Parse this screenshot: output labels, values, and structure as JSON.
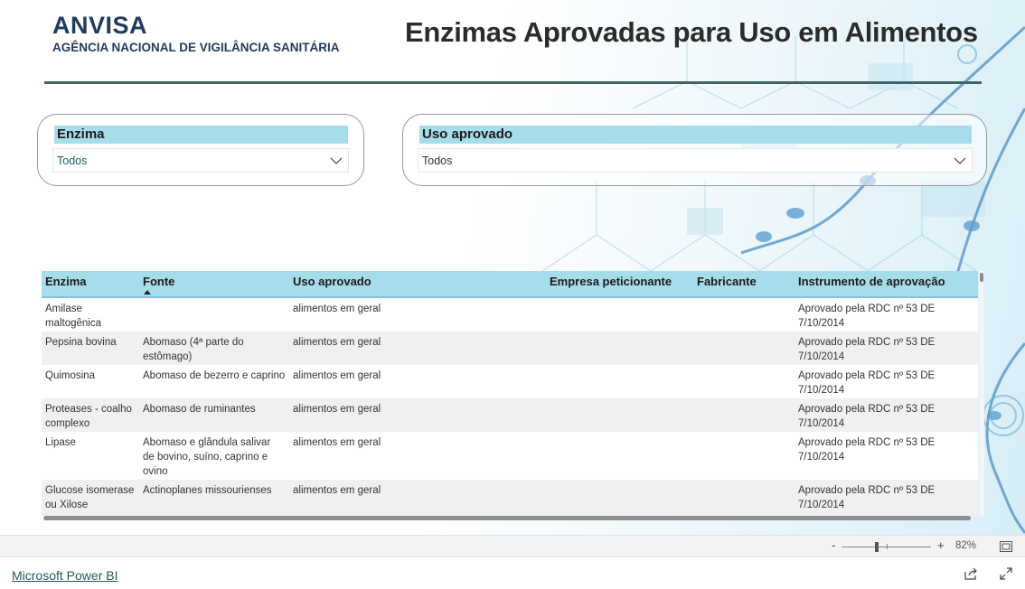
{
  "header": {
    "logo_title": "ANVISA",
    "logo_subtitle": "AGÊNCIA NACIONAL DE VIGILÂNCIA SANITÁRIA",
    "page_title": "Enzimas Aprovadas para Uso em Alimentos"
  },
  "slicers": {
    "enzima": {
      "label": "Enzima",
      "value": "Todos"
    },
    "uso": {
      "label": "Uso aprovado",
      "value": "Todos"
    }
  },
  "table": {
    "columns": [
      "Enzima",
      "Fonte",
      "Uso aprovado",
      "Empresa peticionante",
      "Fabricante",
      "Instrumento de aprovação"
    ],
    "sorted_column": "Fonte",
    "sort_direction": "ascending",
    "rows": [
      {
        "enzima": "Amilase maltogênica",
        "fonte": "",
        "uso": "alimentos em geral",
        "empresa": "",
        "fabricante": "",
        "instrumento": "Aprovado pela RDC nº 53 DE 7/10/2014"
      },
      {
        "enzima": "Pepsina bovina",
        "fonte": "Abomaso (4ª parte do estômago)",
        "uso": "alimentos em geral",
        "empresa": "",
        "fabricante": "",
        "instrumento": "Aprovado pela RDC nº 53 DE 7/10/2014"
      },
      {
        "enzima": "Quimosina",
        "fonte": "Abomaso de bezerro e caprino",
        "uso": "alimentos em geral",
        "empresa": "",
        "fabricante": "",
        "instrumento": "Aprovado pela RDC nº 53 DE 7/10/2014"
      },
      {
        "enzima": "Proteases - coalho complexo",
        "fonte": "Abomaso de ruminantes",
        "uso": "alimentos em geral",
        "empresa": "",
        "fabricante": "",
        "instrumento": "Aprovado pela RDC nº 53 DE 7/10/2014"
      },
      {
        "enzima": "Lipase",
        "fonte": "Abomaso e glândula salivar de bovino, suíno, caprino e ovino",
        "uso": "alimentos em geral",
        "empresa": "",
        "fabricante": "",
        "instrumento": "Aprovado pela RDC nº 53 DE 7/10/2014"
      },
      {
        "enzima": "Glucose isomerase ou Xilose",
        "fonte": "Actinoplanes missourienses",
        "uso": "alimentos em geral",
        "empresa": "",
        "fabricante": "",
        "instrumento": "Aprovado pela RDC nº 53 DE 7/10/2014"
      }
    ]
  },
  "chrome": {
    "zoom_minus": "-",
    "zoom_plus": "+",
    "zoom_level": "82%",
    "powerbi_link": "Microsoft Power BI"
  },
  "colors": {
    "header_fill": "#a7dceb",
    "title_navy": "#1f3b5e",
    "rule": "#3e6466",
    "link": "#1f5b5d"
  },
  "icons": [
    "chevron-down-icon",
    "sort-ascending-icon",
    "fit-to-page-icon",
    "share-icon",
    "expand-icon"
  ]
}
